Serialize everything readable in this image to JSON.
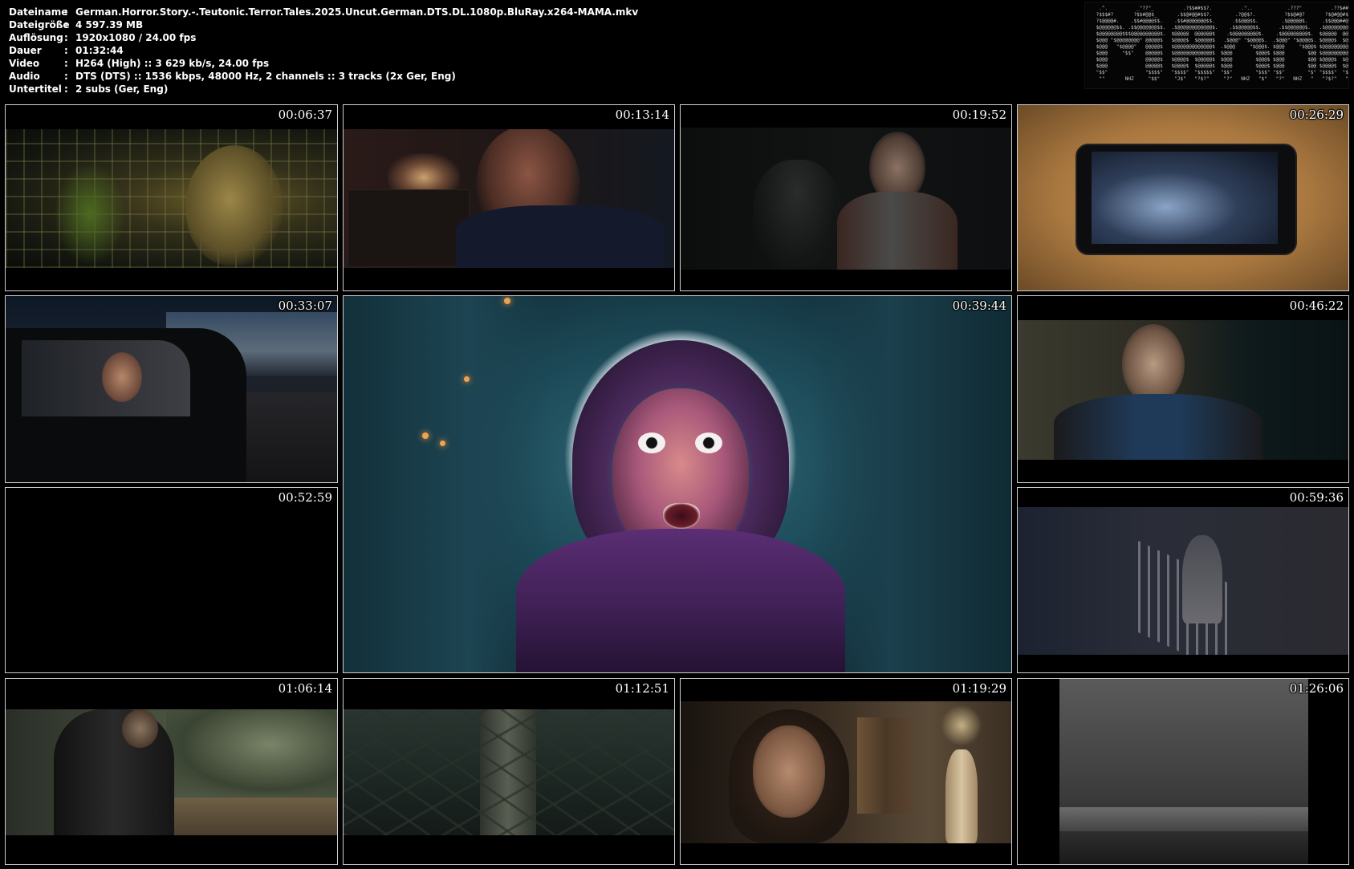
{
  "info": {
    "rows": [
      {
        "key": "Dateiname",
        "sep": ":",
        "value": "German.Horror.Story.-.Teutonic.Terror.Tales.2025.Uncut.German.DTS.DL.1080p.BluRay.x264-MAMA.mkv"
      },
      {
        "key": "Dateigröße",
        "sep": ":",
        "value": "4 597.39 MB"
      },
      {
        "key": "Auflösung",
        "sep": ":",
        "value": "1920x1080 / 24.00 fps"
      },
      {
        "key": "Dauer",
        "sep": ":",
        "value": "01:32:44"
      },
      {
        "key": "Video",
        "sep": ":",
        "value": "H264 (High) :: 3 629 kb/s, 24.00 fps"
      },
      {
        "key": "Audio",
        "sep": ":",
        "value": "DTS (DTS) :: 1536 kbps, 48000 Hz, 2 channels :: 3 tracks (2x Ger, Eng)"
      },
      {
        "key": "Untertitel",
        "sep": ":",
        "value": "2 subs (Ger, Eng)"
      }
    ]
  },
  "logo": {
    "icon": "mama-ascii-art-logo",
    "text": "MAMA"
  },
  "thumbnails": [
    {
      "time": "00:06:37"
    },
    {
      "time": "00:13:14"
    },
    {
      "time": "00:19:52"
    },
    {
      "time": "00:26:29"
    },
    {
      "time": "00:33:07"
    },
    {
      "time": "00:39:44"
    },
    {
      "time": "00:46:22"
    },
    {
      "time": "00:52:59"
    },
    {
      "time": "00:59:36"
    },
    {
      "time": "01:06:14"
    },
    {
      "time": "01:12:51"
    },
    {
      "time": "01:19:29"
    },
    {
      "time": "01:26:06"
    }
  ]
}
